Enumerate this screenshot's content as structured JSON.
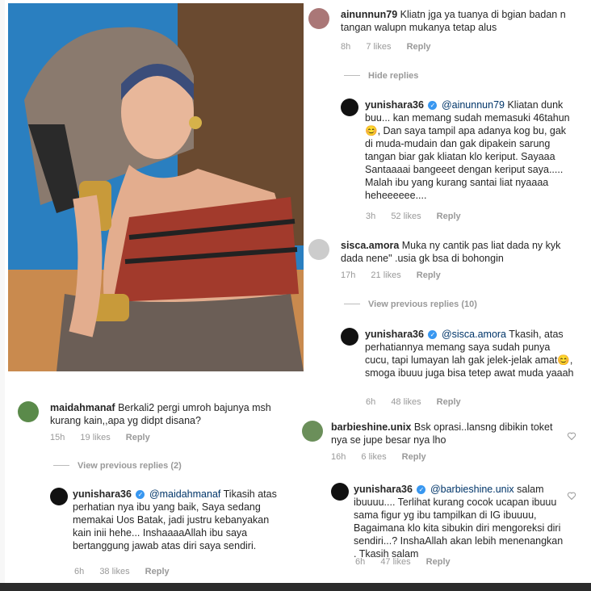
{
  "comments": {
    "c1": {
      "user": "ainunnun79",
      "text": "Kliatn jga ya tuanya di bgian badan n tangan walupn mukanya tetap alus",
      "time": "8h",
      "likes": "7 likes",
      "reply": "Reply"
    },
    "hide_replies": "Hide replies",
    "r1": {
      "user": "yunishara36",
      "mention": "@ainunnun79",
      "text": "Kliatan dunk buu... kan memang sudah memasuki 46tahun😊, Dan saya tampil apa adanya kog bu, gak di muda-mudain dan gak dipakein sarung tangan biar gak kliatan klo keriput.  Sayaaa Santaaaai bangeeet dengan keriput saya..... Malah ibu yang kurang santai liat nyaaaa heheeeeee....",
      "time": "3h",
      "likes": "52 likes",
      "reply": "Reply"
    },
    "c2": {
      "user": "sisca.amora",
      "text": "Muka ny cantik pas liat dada ny kyk dada nene\" .usia gk bsa di bohongin",
      "time": "17h",
      "likes": "21 likes",
      "reply": "Reply"
    },
    "view_prev_10": "View previous replies (10)",
    "r2": {
      "user": "yunishara36",
      "mention": "@sisca.amora",
      "text": "Tkasih, atas perhatiannya memang saya sudah punya cucu, tapi lumayan lah gak jelek-jelak amat😊, smoga ibuuu juga bisa tetep awat muda yaaah",
      "time": "6h",
      "likes": "48 likes",
      "reply": "Reply"
    },
    "c3": {
      "user": "maidahmanaf",
      "text": "Berkali2 pergi umroh bajunya msh kurang kain,,apa yg didpt disana?",
      "time": "15h",
      "likes": "19 likes",
      "reply": "Reply"
    },
    "view_prev_2": "View previous replies (2)",
    "r3": {
      "user": "yunishara36",
      "mention": "@maidahmanaf",
      "text": "Tikasih atas perhatian nya ibu yang baik,  Saya sedang memakai Uos Batak, jadi justru kebanyakan kain inii hehe... InshaaaaAllah ibu saya bertanggung jawab atas diri saya sendiri.",
      "time": "6h",
      "likes": "38 likes",
      "reply": "Reply"
    },
    "c4": {
      "user": "barbieshine.unix",
      "text": "Bsk oprasi..lansng dibikin toket nya se jupe besar nya lho",
      "time": "16h",
      "likes": "6 likes",
      "reply": "Reply"
    },
    "r4": {
      "user": "yunishara36",
      "mention": "@barbieshine.unix",
      "text": "salam ibuuuu.... Terlihat kurang cocok ucapan ibuuu sama figur yg ibu tampilkan di IG ibuuuu, Bagaimana klo kita sibukin diri mengoreksi diri sendiri...? InshaAllah akan lebih menenangkan . Tkasih salam",
      "time": "6h",
      "likes": "47 likes",
      "reply": "Reply"
    }
  },
  "icons": {
    "verified": "verified-badge-icon",
    "heart": "heart-outline-icon"
  }
}
